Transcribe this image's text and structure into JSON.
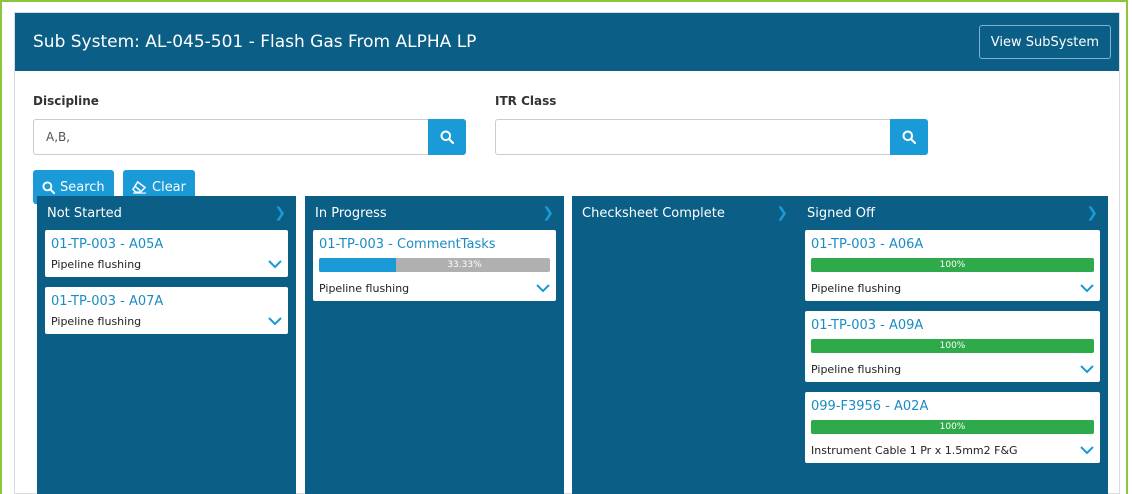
{
  "header": {
    "title": "Sub System: AL-045-501 - Flash Gas From ALPHA LP",
    "view_button": "View SubSystem"
  },
  "filters": {
    "discipline": {
      "label": "Discipline",
      "value": "A,B,",
      "icon": "search-icon"
    },
    "itr_class": {
      "label": "ITR Class",
      "value": "",
      "icon": "search-icon"
    }
  },
  "actions": {
    "search_label": "Search",
    "search_icon": "search-icon",
    "clear_label": "Clear",
    "clear_icon": "eraser-icon"
  },
  "colors": {
    "header_bg": "#0b5e86",
    "accent": "#1a9ad6",
    "progress_blue": "#1a9ad6",
    "progress_green": "#2eaa4a"
  },
  "columns": [
    {
      "title": "Not Started",
      "cards": [
        {
          "id": "01-TP-003 - A05A",
          "desc": "Pipeline flushing"
        },
        {
          "id": "01-TP-003 - A07A",
          "desc": "Pipeline flushing"
        }
      ]
    },
    {
      "title": "In Progress",
      "cards": [
        {
          "id": "01-TP-003 - CommentTasks",
          "progress": 33.33,
          "progress_text": "33.33%",
          "desc": "Pipeline flushing"
        }
      ]
    },
    {
      "title": "Checksheet Complete",
      "cards": []
    },
    {
      "title": "Signed Off",
      "cards": [
        {
          "id": "01-TP-003 - A06A",
          "progress": 100,
          "progress_text": "100%",
          "desc": "Pipeline flushing"
        },
        {
          "id": "01-TP-003 - A09A",
          "progress": 100,
          "progress_text": "100%",
          "desc": "Pipeline flushing"
        },
        {
          "id": "099-F3956 - A02A",
          "progress": 100,
          "progress_text": "100%",
          "desc": "Instrument Cable 1 Pr x 1.5mm2 F&G"
        }
      ]
    }
  ]
}
